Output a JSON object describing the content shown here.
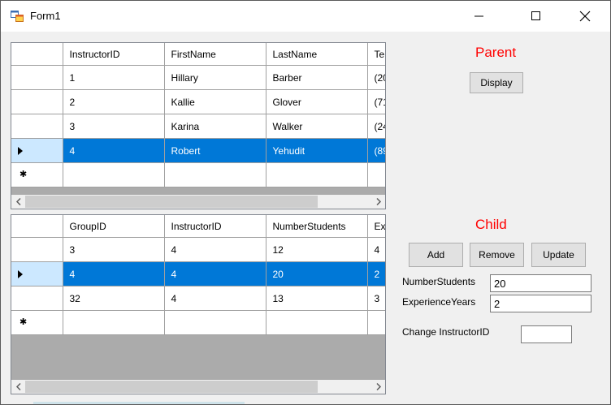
{
  "window": {
    "title": "Form1"
  },
  "parent_grid": {
    "columns": [
      "InstructorID",
      "FirstName",
      "LastName",
      "Te"
    ],
    "rows": [
      [
        "1",
        "Hillary",
        "Barber",
        "(20"
      ],
      [
        "2",
        "Kallie",
        "Glover",
        "(71"
      ],
      [
        "3",
        "Karina",
        "Walker",
        "(24"
      ],
      [
        "4",
        "Robert",
        "Yehudit",
        "(89"
      ]
    ],
    "selected_row": 3
  },
  "child_grid": {
    "columns": [
      "GroupID",
      "InstructorID",
      "NumberStudents",
      "Ex"
    ],
    "rows": [
      [
        "3",
        "4",
        "12",
        "4"
      ],
      [
        "4",
        "4",
        "20",
        "2"
      ],
      [
        "32",
        "4",
        "13",
        "3"
      ]
    ],
    "selected_row": 1
  },
  "parent_section": {
    "label": "Parent",
    "display_button": "Display"
  },
  "child_section": {
    "label": "Child",
    "add_button": "Add",
    "remove_button": "Remove",
    "update_button": "Update",
    "number_students_label": "NumberStudents",
    "number_students_value": "20",
    "experience_years_label": "ExperienceYears",
    "experience_years_value": "2",
    "change_instructor_label": "Change InstructorID",
    "change_instructor_value": ""
  },
  "colors": {
    "selection": "#0078d7",
    "accent_label": "#ff0000",
    "row_header_selected": "#cce8ff"
  }
}
